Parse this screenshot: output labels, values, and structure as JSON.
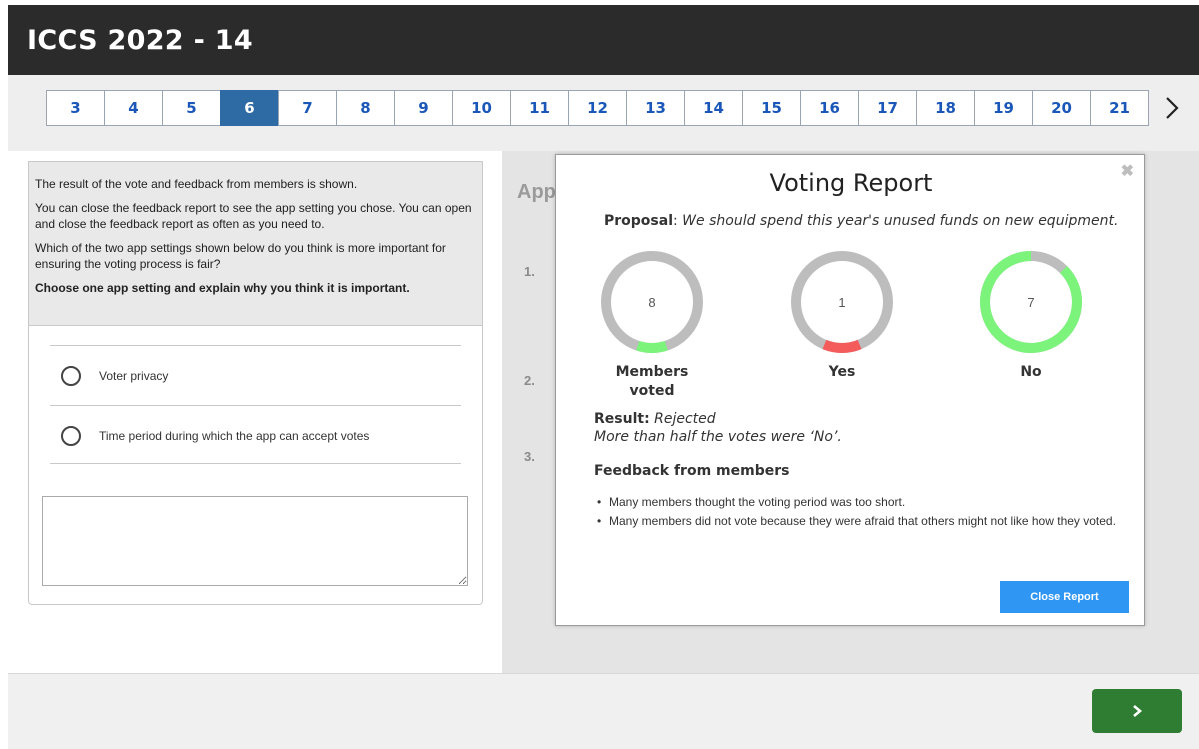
{
  "header": {
    "title": "ICCS 2022 - 14"
  },
  "pager": {
    "pages": [
      "3",
      "4",
      "5",
      "6",
      "7",
      "8",
      "9",
      "10",
      "11",
      "12",
      "13",
      "14",
      "15",
      "16",
      "17",
      "18",
      "19",
      "20",
      "21"
    ],
    "active": "6",
    "next_icon": "chevron-right-icon"
  },
  "instructions": {
    "p1": "The result of the vote and feedback from members is shown.",
    "p2": "You can close the feedback report to see the app setting you chose. You can open and close the feedback report as often as you need to.",
    "p3": "Which of the two app settings shown below do you think is more important for ensuring the voting process is fair?",
    "p4": "Choose one app setting and explain why you think it is important."
  },
  "options": [
    {
      "label": "Voter privacy"
    },
    {
      "label": "Time period during which the app can accept votes"
    }
  ],
  "answer": {
    "value": ""
  },
  "background": {
    "title": "App",
    "numbers": [
      "1.",
      "2.",
      "3."
    ]
  },
  "modal": {
    "title": "Voting Report",
    "close_icon": "close-icon",
    "proposal_label": "Proposal",
    "proposal_sep": ":",
    "proposal_text": " We should spend this year's unused funds on new equipment.",
    "stats": [
      {
        "value": "8",
        "label_line1": "Members",
        "label_line2": "voted",
        "fraction": 0.1,
        "color": "#7cf47c"
      },
      {
        "value": "1",
        "label_line1": "Yes",
        "label_line2": "",
        "fraction": 0.125,
        "color": "#f45b5b"
      },
      {
        "value": "7",
        "label_line1": "No",
        "label_line2": "",
        "fraction": 0.875,
        "color": "#7cf47c"
      }
    ],
    "track_color": "#bdbdbd",
    "result_label": "Result:",
    "result_value": "Rejected",
    "result_detail": "More than half the votes were ‘No’.",
    "feedback_heading": "Feedback from members",
    "feedback": [
      "Many members thought the voting period was too short.",
      "Many members did not vote because they were afraid that others might not like how they voted."
    ],
    "close_button": "Close Report"
  },
  "footer": {
    "next_icon": "chevron-right-icon"
  }
}
